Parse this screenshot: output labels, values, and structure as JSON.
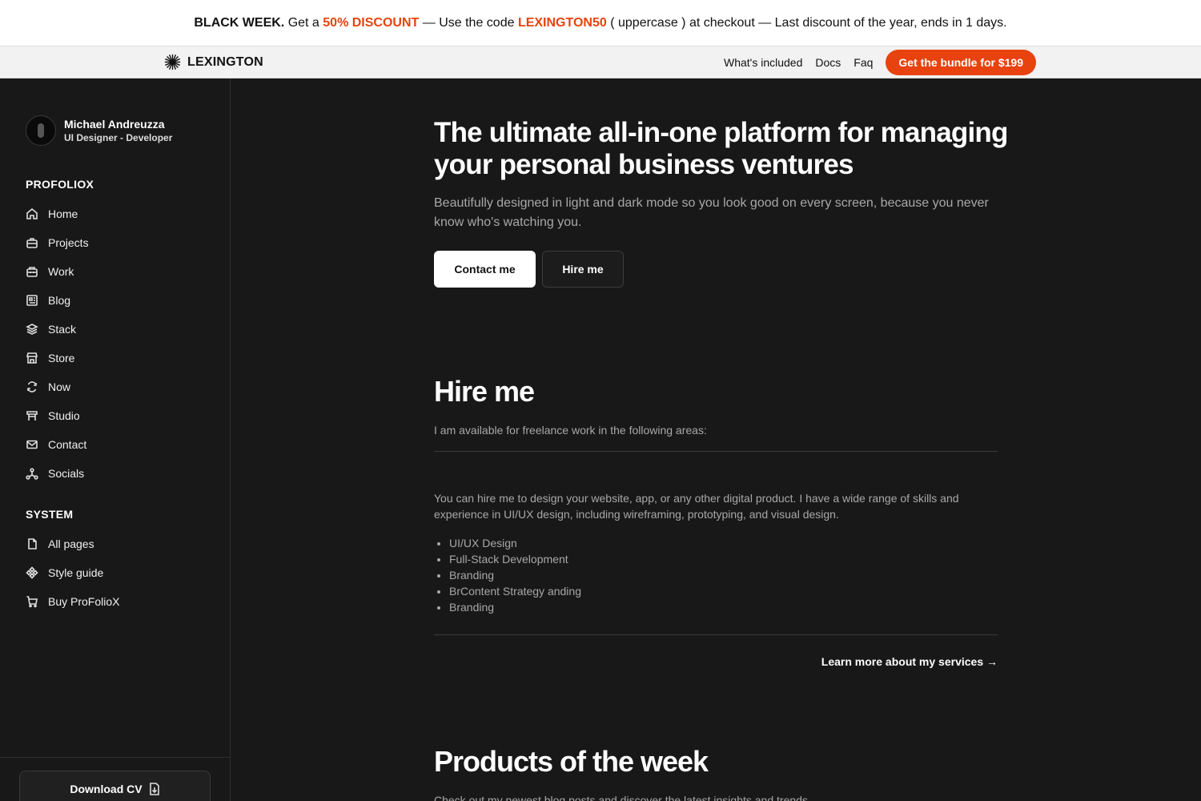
{
  "promo": {
    "lead": "BLACK WEEK.",
    "t1": " Get a ",
    "discount": "50% DISCOUNT",
    "t2": " — Use the code ",
    "code": "LEXINGTON50",
    "t3": " ( uppercase ) at checkout — Last discount of the year, ends in 1 days."
  },
  "topnav": {
    "brand": "LEXINGTON",
    "links": [
      "What's included",
      "Docs",
      "Faq"
    ],
    "cta": "Get the bundle for $199"
  },
  "profile": {
    "name": "Michael Andreuzza",
    "role": "UI Designer - Developer"
  },
  "sidebar": {
    "section1": "PROFOLIOX",
    "items1": [
      {
        "label": "Home",
        "icon": "home-icon"
      },
      {
        "label": "Projects",
        "icon": "briefcase-icon"
      },
      {
        "label": "Work",
        "icon": "toolbox-icon"
      },
      {
        "label": "Blog",
        "icon": "newspaper-icon"
      },
      {
        "label": "Stack",
        "icon": "layers-icon"
      },
      {
        "label": "Store",
        "icon": "store-icon"
      },
      {
        "label": "Now",
        "icon": "refresh-icon"
      },
      {
        "label": "Studio",
        "icon": "studio-icon"
      },
      {
        "label": "Contact",
        "icon": "mail-icon"
      },
      {
        "label": "Socials",
        "icon": "share-icon"
      }
    ],
    "section2": "SYSTEM",
    "items2": [
      {
        "label": "All pages",
        "icon": "file-icon"
      },
      {
        "label": "Style guide",
        "icon": "components-icon"
      },
      {
        "label": "Buy ProFolioX",
        "icon": "cart-icon"
      }
    ],
    "download": "Download CV"
  },
  "hero": {
    "title": "The ultimate all-in-one platform for managing your personal business ventures",
    "subtitle": "Beautifully designed in light and dark mode so you look good on every screen, because you never know who's watching you.",
    "contact": "Contact me",
    "hire": "Hire me"
  },
  "hire": {
    "title": "Hire me",
    "intro": "I am available for freelance work in the following areas:",
    "body": "You can hire me to design your website, app, or any other digital product. I have a wide range of skills and experience in UI/UX design, including wireframing, prototyping, and visual design.",
    "skills": [
      "UI/UX Design",
      "Full-Stack Development",
      "Branding",
      "BrContent Strategy anding",
      "Branding"
    ],
    "learn_more": "Learn more about my services →"
  },
  "products": {
    "title": "Products of the week",
    "intro": "Check out my newest blog posts and discover the latest insights and trends."
  },
  "colors": {
    "accent": "#e8420e",
    "background": "#181818"
  }
}
